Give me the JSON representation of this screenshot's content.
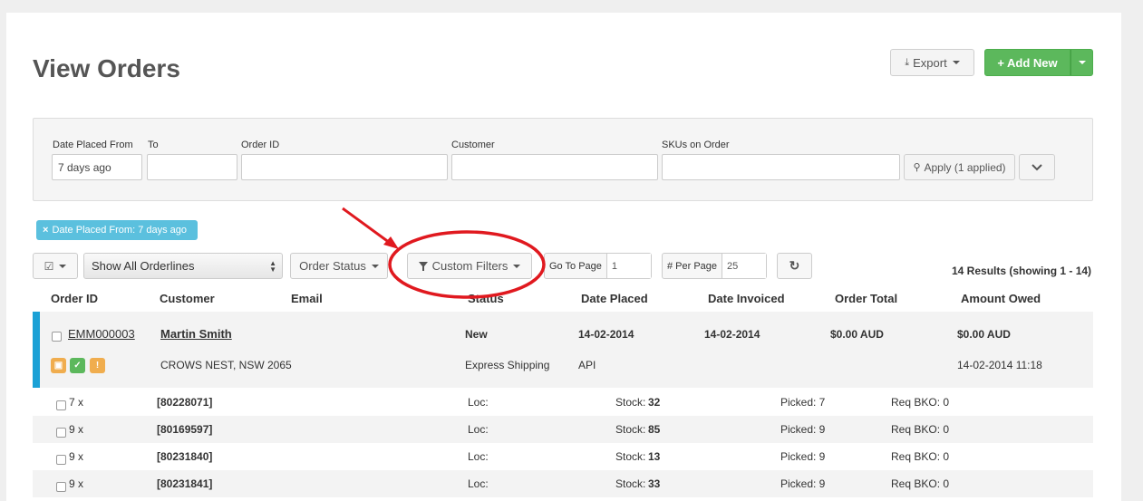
{
  "page_title": "View Orders",
  "toolbar": {
    "export_label": "Export",
    "add_new_label": "Add New"
  },
  "filters": {
    "date_from_label": "Date Placed From",
    "date_from_value": "7 days ago",
    "to_label": "To",
    "to_value": "",
    "order_id_label": "Order ID",
    "customer_label": "Customer",
    "skus_label": "SKUs on Order",
    "apply_label": "Apply (1 applied)"
  },
  "active_filter_badge": "Date Placed From: 7 days ago",
  "controls": {
    "orderlines_select": "Show All Orderlines",
    "order_status_label": "Order Status",
    "custom_filters_label": "Custom Filters",
    "go_to_page_label": "Go To Page",
    "go_to_page_value": "1",
    "per_page_label": "# Per Page",
    "per_page_value": "25",
    "results_text": "14 Results (showing 1 - 14)"
  },
  "table": {
    "headers": [
      "Order ID",
      "Customer",
      "Email",
      "Status",
      "Date Placed",
      "Date Invoiced",
      "Order Total",
      "Amount Owed"
    ]
  },
  "order": {
    "id": "EMM000003",
    "customer": "Martin Smith",
    "status": "New",
    "date_placed": "14-02-2014",
    "date_invoiced": "14-02-2014",
    "order_total": "$0.00 AUD",
    "amount_owed": "$0.00 AUD",
    "location": "CROWS NEST, NSW 2065",
    "shipping": "Express Shipping",
    "source": "API",
    "timestamp": "14-02-2014 11:18"
  },
  "orderlines": [
    {
      "qty": "7 x",
      "sku": "[80228071]",
      "loc": "Loc:",
      "stock_label": "Stock:",
      "stock": "32",
      "picked": "Picked: 7",
      "bko": "Req BKO: 0"
    },
    {
      "qty": "9 x",
      "sku": "[80169597]",
      "loc": "Loc:",
      "stock_label": "Stock:",
      "stock": "85",
      "picked": "Picked: 9",
      "bko": "Req BKO: 0"
    },
    {
      "qty": "9 x",
      "sku": "[80231840]",
      "loc": "Loc:",
      "stock_label": "Stock:",
      "stock": "13",
      "picked": "Picked: 9",
      "bko": "Req BKO: 0"
    },
    {
      "qty": "9 x",
      "sku": "[80231841]",
      "loc": "Loc:",
      "stock_label": "Stock:",
      "stock": "33",
      "picked": "Picked: 9",
      "bko": "Req BKO: 0"
    }
  ],
  "colors": {
    "accent_blue": "#1ba1d6",
    "success_green": "#5cb85c",
    "warning_orange": "#f0ad4e",
    "annotation_red": "#e0191f"
  }
}
